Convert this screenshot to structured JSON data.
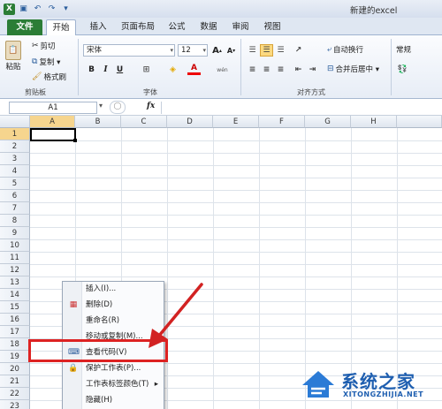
{
  "window": {
    "title": "新建的excel"
  },
  "tabs": [
    "文件",
    "开始",
    "插入",
    "页面布局",
    "公式",
    "数据",
    "审阅",
    "视图"
  ],
  "ribbon": {
    "clipboard": {
      "paste": "粘贴",
      "cut": "剪切",
      "copy": "复制 ▾",
      "format_painter": "格式刷",
      "label": "剪贴板"
    },
    "font": {
      "name": "宋体",
      "size": "12",
      "grow": "A",
      "shrink": "A",
      "bold": "B",
      "italic": "I",
      "underline": "U",
      "label": "字体",
      "wen": "wén"
    },
    "alignment": {
      "wrap": "自动换行",
      "merge": "合并后居中 ▾",
      "label": "对齐方式"
    },
    "number": {
      "format": "常规"
    }
  },
  "formula_bar": {
    "cell_ref": "A1",
    "fx": "fx"
  },
  "columns": [
    "A",
    "B",
    "C",
    "D",
    "E",
    "F",
    "G",
    "H"
  ],
  "rows": [
    "1",
    "2",
    "3",
    "4",
    "5",
    "6",
    "7",
    "8",
    "9",
    "10",
    "11",
    "12",
    "13",
    "14",
    "15",
    "16",
    "17",
    "18",
    "19",
    "20",
    "21",
    "22",
    "23"
  ],
  "context_menu": {
    "items": [
      {
        "label": "插入(I)...",
        "icon": "insert-icon"
      },
      {
        "label": "删除(D)",
        "icon": "delete-sheet-icon"
      },
      {
        "label": "重命名(R)",
        "icon": ""
      },
      {
        "label": "移动或复制(M)...",
        "icon": ""
      },
      {
        "label": "查看代码(V)",
        "icon": "view-code-icon"
      },
      {
        "label": "保护工作表(P)...",
        "icon": "protect-sheet-icon"
      },
      {
        "label": "工作表标签颜色(T)",
        "icon": "",
        "submenu": "▸"
      },
      {
        "label": "隐藏(H)",
        "icon": ""
      }
    ]
  },
  "annotation": {
    "highlight_color": "#d22222"
  },
  "watermark": {
    "name": "系统之家",
    "url": "XITONGZHIJIA.NET"
  },
  "colors": {
    "file_tab": "#2b7d36",
    "active_cell": "#000000",
    "accent": "#2a5d9c"
  }
}
